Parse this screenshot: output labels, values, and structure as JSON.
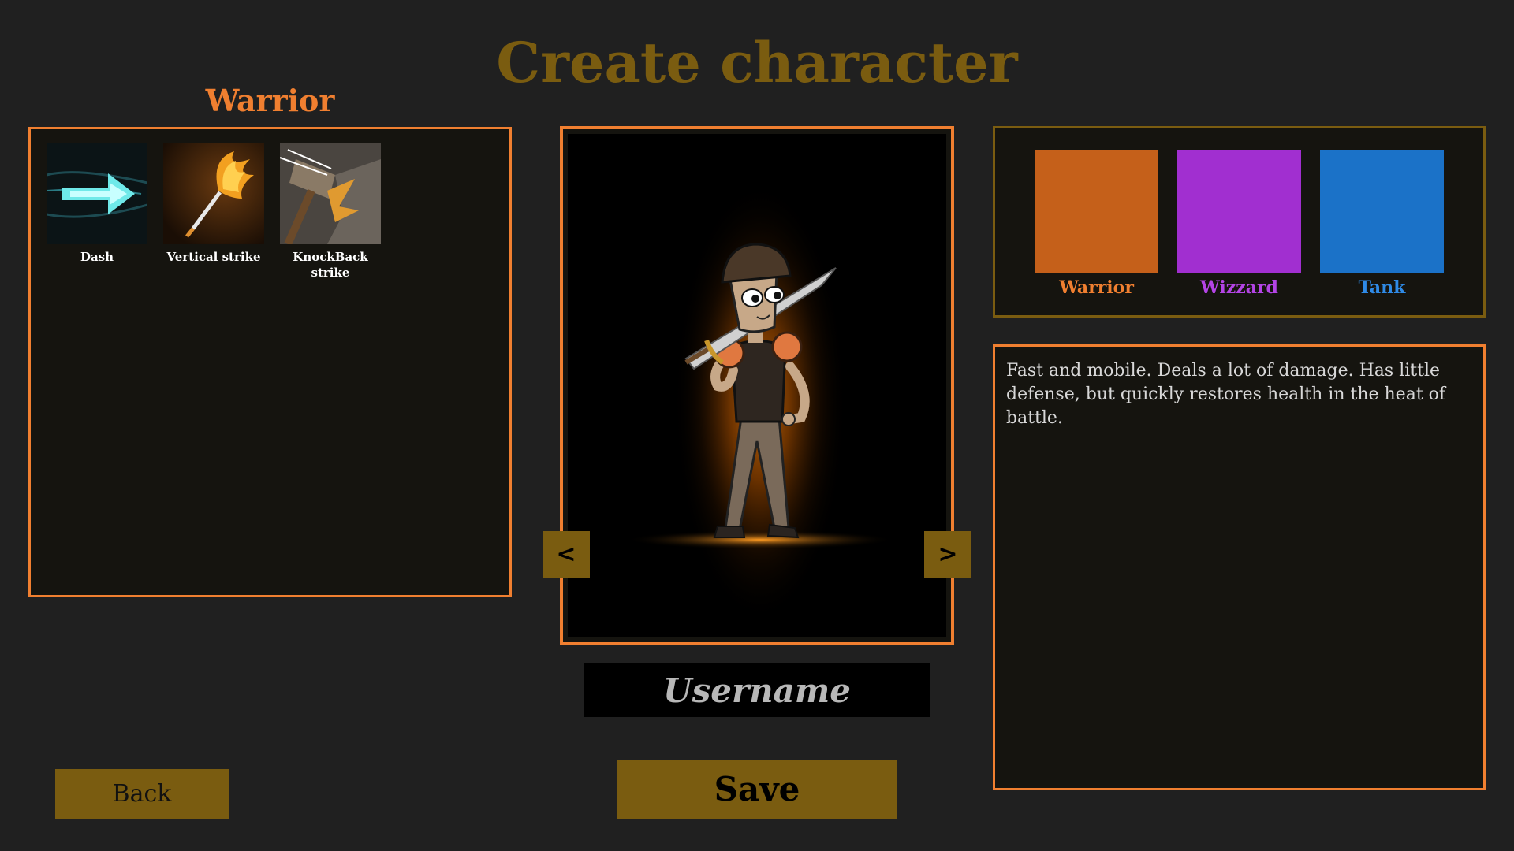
{
  "title": "Create character",
  "selected_class": {
    "name": "Warrior",
    "color": "#f07f30",
    "description": "Fast and mobile. Deals a lot of damage. Has little defense, but quickly restores health in the heat of battle."
  },
  "skills": [
    {
      "label": "Dash",
      "icon": "dash-icon"
    },
    {
      "label": "Vertical strike",
      "icon": "vertical-strike-icon"
    },
    {
      "label": "KnockBack strike",
      "icon": "knockback-strike-icon"
    }
  ],
  "nav": {
    "prev_label": "<",
    "next_label": ">"
  },
  "username": {
    "placeholder": "Username",
    "value": ""
  },
  "buttons": {
    "save": "Save",
    "back": "Back"
  },
  "classes": [
    {
      "name": "Warrior",
      "color": "#c5601a",
      "text_color": "#f07f30"
    },
    {
      "name": "Wizzard",
      "color": "#a12fd0",
      "text_color": "#b444e6"
    },
    {
      "name": "Tank",
      "color": "#1b72c8",
      "text_color": "#2f8ae6"
    }
  ],
  "colors": {
    "accent": "#f07f30",
    "gold": "#7a5c10",
    "background": "#202020"
  }
}
